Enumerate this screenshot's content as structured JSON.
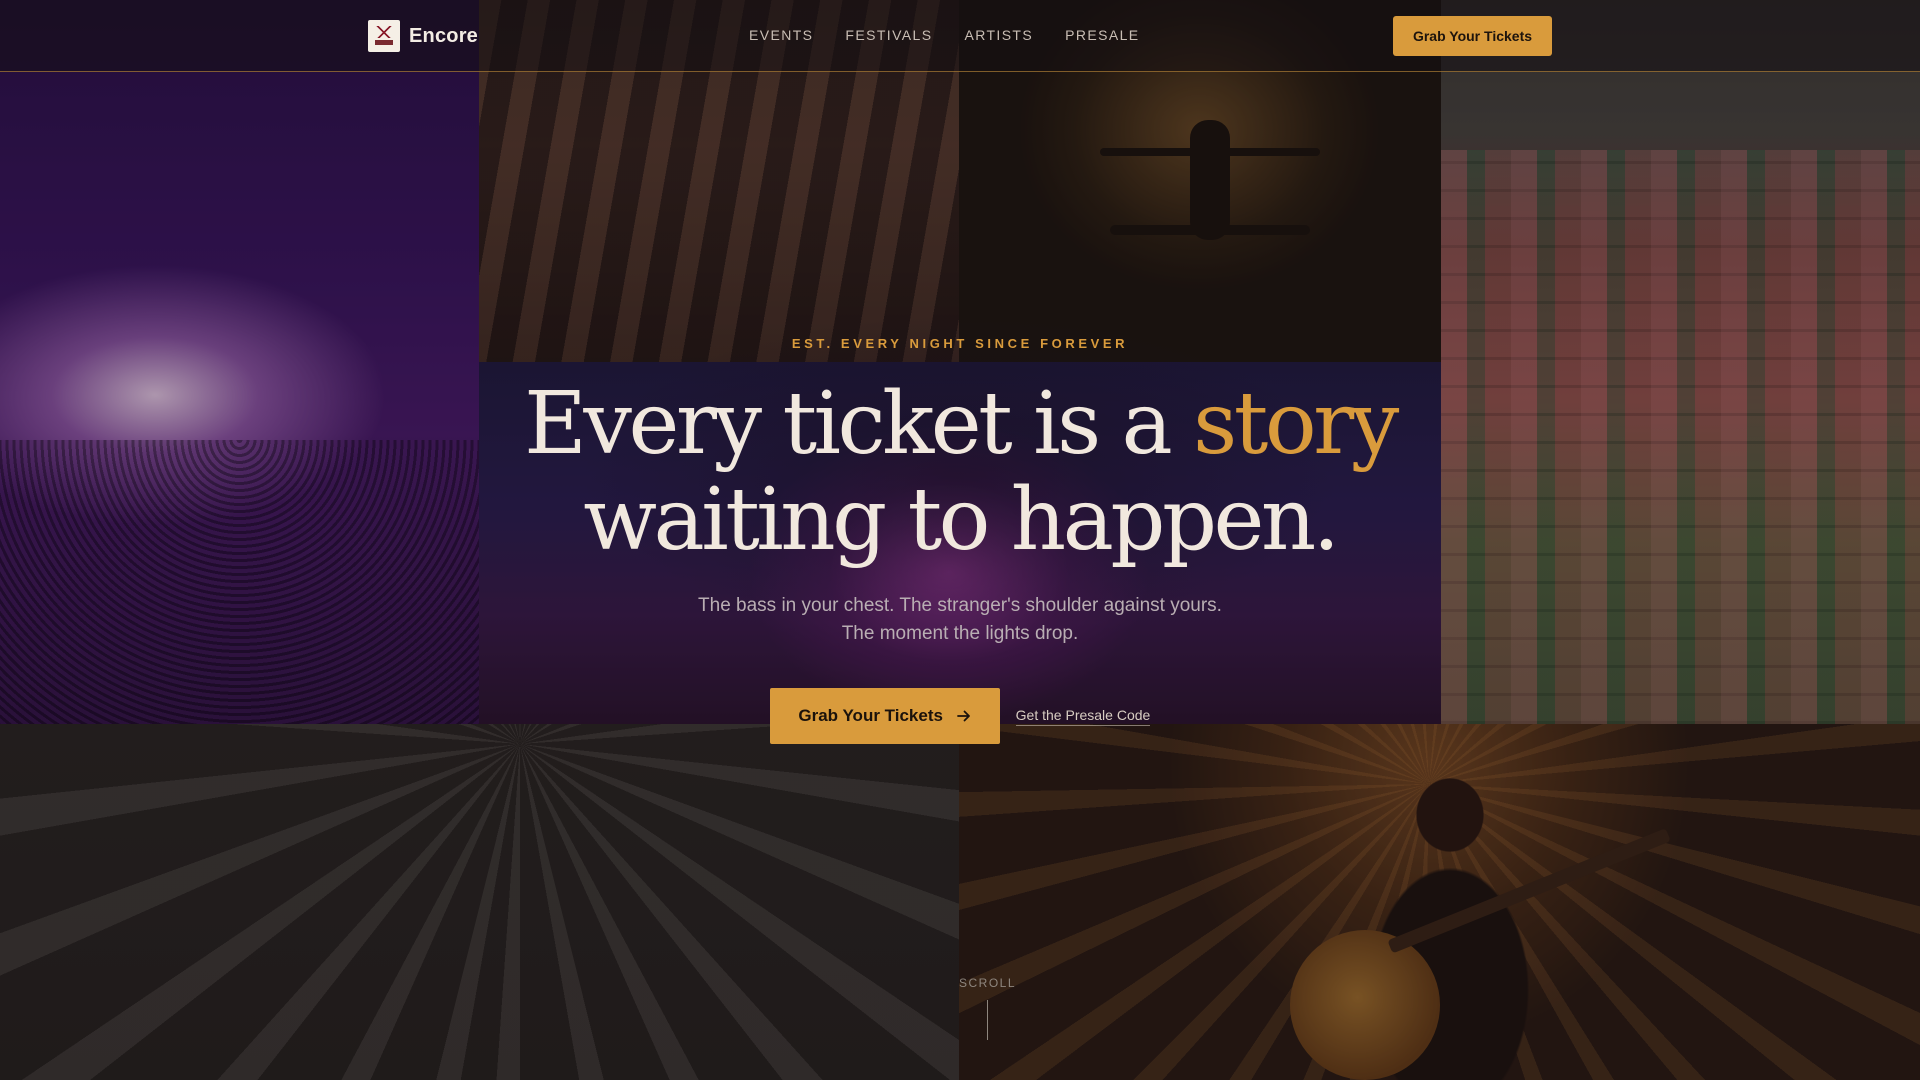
{
  "brand": {
    "name": "Encore"
  },
  "nav": {
    "items": [
      "EVENTS",
      "FESTIVALS",
      "ARTISTS",
      "PRESALE"
    ],
    "cta_label": "Grab Your Tickets"
  },
  "hero": {
    "eyebrow": "EST. EVERY NIGHT SINCE FOREVER",
    "headline_part1": "Every ticket is a ",
    "headline_accent": "story",
    "headline_part2": "waiting to happen.",
    "sub_line1": "The bass in your chest. The stranger's shoulder against yours.",
    "sub_line2": "The moment the lights drop.",
    "primary_cta": "Grab Your Tickets",
    "primary_cta_icon": "arrow-right-icon",
    "secondary_link": "Get the Presale Code"
  },
  "scroll": {
    "label": "SCROLL"
  },
  "colors": {
    "accent": "#d99b3c",
    "background": "#17131a",
    "text": "#f1e8de"
  }
}
